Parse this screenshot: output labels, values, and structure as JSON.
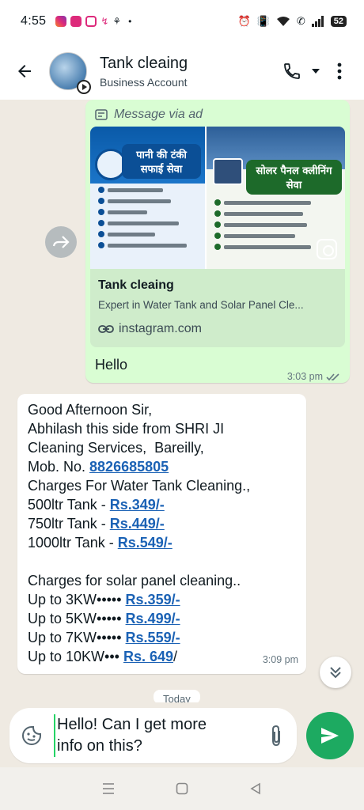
{
  "status_bar": {
    "time": "4:55",
    "dot": "•",
    "battery": "52"
  },
  "header": {
    "name": "Tank cleaing",
    "subtitle": "Business Account"
  },
  "ad_message": {
    "label": "Message via ad",
    "image_text_left": "पानी की टंकी सफाई सेवा",
    "image_text_right": "सोलर पैनल क्लीनिंग सेवा",
    "title": "Tank cleaing",
    "description": "Expert in Water Tank and Solar Panel Cle...",
    "link": "instagram.com",
    "text": "Hello",
    "time": "3:03 pm"
  },
  "incoming_message": {
    "lines": [
      {
        "text": "Good Afternoon Sir,",
        "link": ""
      },
      {
        "text": "Abhilash this side from SHRI JI",
        "link": ""
      },
      {
        "text": "Cleaning Services,  Bareilly,",
        "link": ""
      },
      {
        "text": "Mob. No. ",
        "link": "8826685805"
      },
      {
        "text": "Charges For Water Tank Cleaning.,",
        "link": ""
      },
      {
        "text": "500ltr Tank - ",
        "link": "Rs.349/-"
      },
      {
        "text": "750ltr Tank - ",
        "link": "Rs.449/-"
      },
      {
        "text": "1000ltr Tank - ",
        "link": "Rs.549/-"
      },
      {
        "text": "",
        "link": ""
      },
      {
        "text": "Charges for solar panel cleaning..",
        "link": ""
      },
      {
        "text": "Up to 3KW••••• ",
        "link": "Rs.359/-"
      },
      {
        "text": "Up to 5KW••••• ",
        "link": "Rs.499/-"
      },
      {
        "text": "Up to 7KW••••• ",
        "link": "Rs.559/-"
      },
      {
        "text": "Up to 10KW••• ",
        "link": "Rs. 649",
        "suffix": "/"
      }
    ],
    "time": "3:09 pm"
  },
  "date_chip": "Today",
  "composer": {
    "text": "Hello! Can I get more\ninfo on this?"
  },
  "colors": {
    "accent": "#1daa61",
    "outgoing_bubble": "#d9fdd3",
    "link": "#1b62b5"
  }
}
